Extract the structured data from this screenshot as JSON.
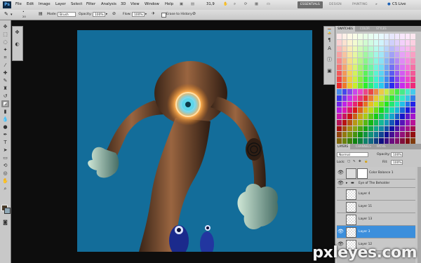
{
  "app": {
    "logo": "Ps",
    "menus": [
      "File",
      "Edit",
      "Image",
      "Layer",
      "Select",
      "Filter",
      "Analysis",
      "3D",
      "View",
      "Window",
      "Help"
    ],
    "zoom": "31,9",
    "workspaces": [
      "ESSENTIALS",
      "DESIGN",
      "PAINTING"
    ],
    "cs_live": "CS Live"
  },
  "options": {
    "brush_size": "20",
    "mode_label": "Mode:",
    "mode_value": "Brush",
    "opacity_label": "Opacity:",
    "opacity_value": "100%",
    "flow_label": "Flow:",
    "flow_value": "100%",
    "erase_to_history": "Erase to History"
  },
  "swatch_panel": {
    "tabs": [
      "SWATCHES",
      "COLOR",
      "STYLES"
    ]
  },
  "layers_panel": {
    "tabs": [
      "LAYERS",
      "CHANNELS",
      "PATHS"
    ],
    "blend_mode": "Normal",
    "opacity_label": "Opacity:",
    "opacity_value": "100%",
    "lock_label": "Lock:",
    "fill_label": "Fill:",
    "fill_value": "100%",
    "layers": [
      {
        "name": "Color Balance 1",
        "selected": false
      },
      {
        "name": "Eye of The Beholder",
        "selected": false
      },
      {
        "name": "Layer 4",
        "selected": false
      },
      {
        "name": "Layer 11",
        "selected": false
      },
      {
        "name": "Layer 13",
        "selected": false
      },
      {
        "name": "Layer 3",
        "selected": true
      },
      {
        "name": "Layer 12",
        "selected": false
      }
    ]
  },
  "watermark": "pxleyes.com",
  "colors": {
    "canvas_bg": "#136d9a",
    "selection": "#3c8fdc",
    "foreground": "#4a3c2a",
    "background": "#8fa7b5"
  }
}
